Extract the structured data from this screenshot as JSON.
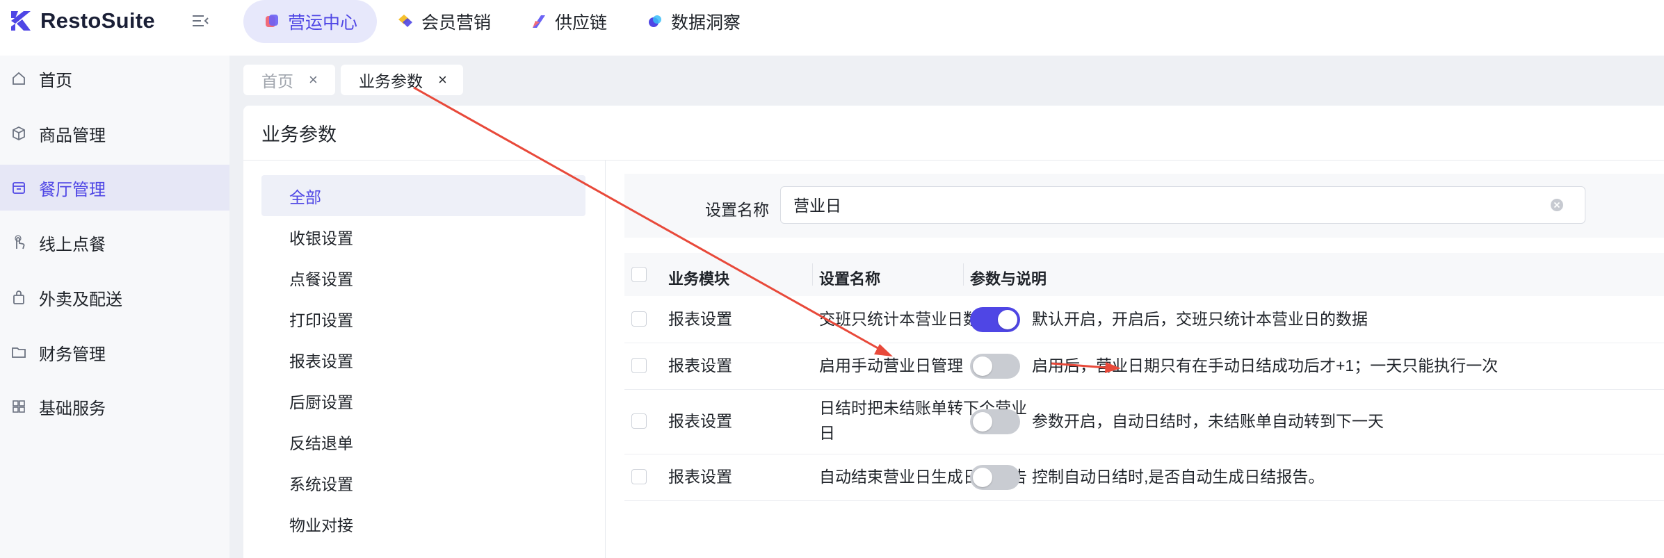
{
  "brand": {
    "name": "RestoSuite",
    "accent": "#4f46e5",
    "annotation_color": "#e8493a"
  },
  "topnav": [
    {
      "label": "营运中心",
      "icon": "ops-center-icon",
      "active": true
    },
    {
      "label": "会员营销",
      "icon": "member-marketing-icon",
      "active": false
    },
    {
      "label": "供应链",
      "icon": "supply-chain-icon",
      "active": false
    },
    {
      "label": "数据洞察",
      "icon": "data-insight-icon",
      "active": false
    }
  ],
  "sidebar": {
    "items": [
      {
        "label": "首页",
        "icon": "home-icon"
      },
      {
        "label": "商品管理",
        "icon": "box-icon"
      },
      {
        "label": "餐厅管理",
        "icon": "store-icon",
        "active": true
      },
      {
        "label": "线上点餐",
        "icon": "hand-tap-icon"
      },
      {
        "label": "外卖及配送",
        "icon": "bag-icon"
      },
      {
        "label": "财务管理",
        "icon": "folder-icon"
      },
      {
        "label": "基础服务",
        "icon": "grid-icon"
      }
    ]
  },
  "page_tabs": [
    {
      "label": "首页",
      "close": "×",
      "active": false
    },
    {
      "label": "业务参数",
      "close": "×",
      "active": true
    }
  ],
  "main": {
    "title": "业务参数",
    "categories": [
      "全部",
      "收银设置",
      "点餐设置",
      "打印设置",
      "报表设置",
      "后厨设置",
      "反结退单",
      "系统设置",
      "物业对接"
    ],
    "filter": {
      "label": "设置名称",
      "value": "营业日"
    },
    "table": {
      "headers": [
        "业务模块",
        "设置名称",
        "参数与说明"
      ],
      "rows": [
        {
          "module": "报表设置",
          "name": "交班只统计本营业日数据",
          "enabled": true,
          "desc": "默认开启，开启后，交班只统计本营业日的数据"
        },
        {
          "module": "报表设置",
          "name": "启用手动营业日管理",
          "enabled": false,
          "desc": "启用后，营业日期只有在手动日结成功后才+1；一天只能执行一次"
        },
        {
          "module": "报表设置",
          "name_line1": "日结时把未结账单转下个营业",
          "name_line2": "日",
          "enabled": false,
          "desc": "参数开启，自动日结时，未结账单自动转到下一天"
        },
        {
          "module": "报表设置",
          "name": "自动结束营业日生成日结报告",
          "enabled": false,
          "desc": "控制自动日结时,是否自动生成日结报告。"
        }
      ]
    }
  }
}
